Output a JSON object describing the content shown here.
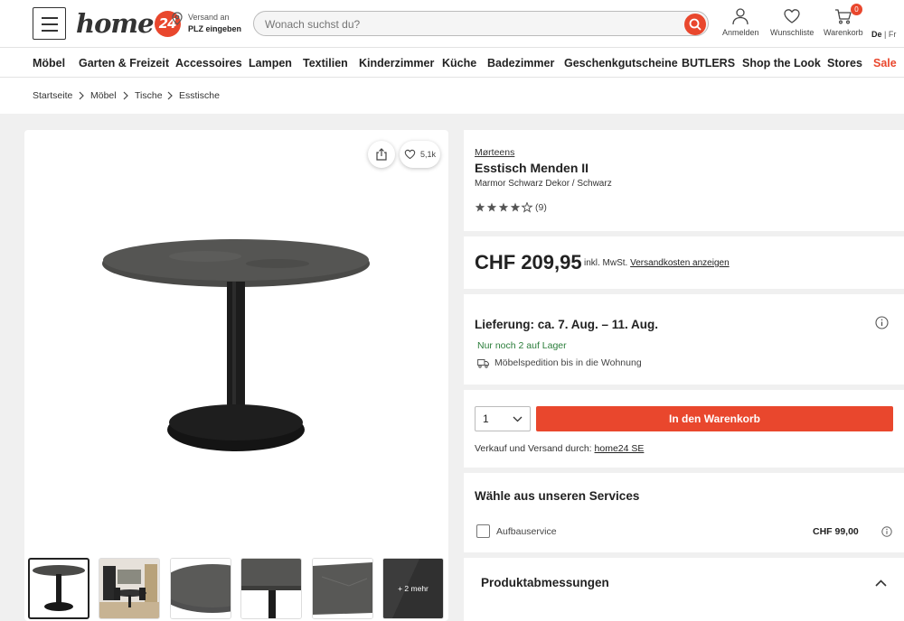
{
  "header": {
    "logo_text": "home",
    "logo_badge": "24",
    "shipping_line1": "Versand an",
    "shipping_line2": "PLZ eingeben",
    "search_placeholder": "Wonach suchst du?",
    "login_label": "Anmelden",
    "wishlist_label": "Wunschliste",
    "cart_label": "Warenkorb",
    "cart_count": "0",
    "lang_active": "De",
    "lang_sep": " | ",
    "lang_other": "Fr"
  },
  "nav": [
    "Möbel",
    "Garten & Freizeit",
    "Accessoires",
    "Lampen",
    "Textilien",
    "Kinderzimmer",
    "Küche",
    "Badezimmer",
    "Geschenkgutscheine",
    "BUTLERS",
    "Shop the Look",
    "Stores",
    "Sale"
  ],
  "breadcrumb": [
    "Startseite",
    "Möbel",
    "Tische",
    "Esstische"
  ],
  "gallery": {
    "favorite_count": "5,1k",
    "more_label": "+ 2 mehr"
  },
  "product": {
    "brand": "Mørteens",
    "title": "Esstisch Menden II",
    "variant": "Marmor Schwarz Dekor / Schwarz",
    "rating": 4,
    "rating_max": 5,
    "review_count": "(9)"
  },
  "price": {
    "amount": "CHF 209,95",
    "note": "inkl. MwSt.",
    "shipping_link": "Versandkosten anzeigen"
  },
  "delivery": {
    "title": "Lieferung: ca. 7. Aug. – 11. Aug.",
    "stock": "Nur noch 2 auf Lager",
    "method": "Möbelspedition bis in die Wohnung"
  },
  "purchase": {
    "quantity": "1",
    "add_to_cart": "In den Warenkorb",
    "seller_text": "Verkauf und Versand durch:",
    "seller_link": "home24 SE"
  },
  "services": {
    "title": "Wähle aus unseren Services",
    "item_name": "Aufbauservice",
    "item_price": "CHF 99,00"
  },
  "dimensions": {
    "title": "Produktabmessungen"
  },
  "colors": {
    "accent": "#e9472d",
    "stock_green": "#2a7d3a",
    "table_top": "#4a4a48",
    "table_base": "#1c1c1c"
  }
}
